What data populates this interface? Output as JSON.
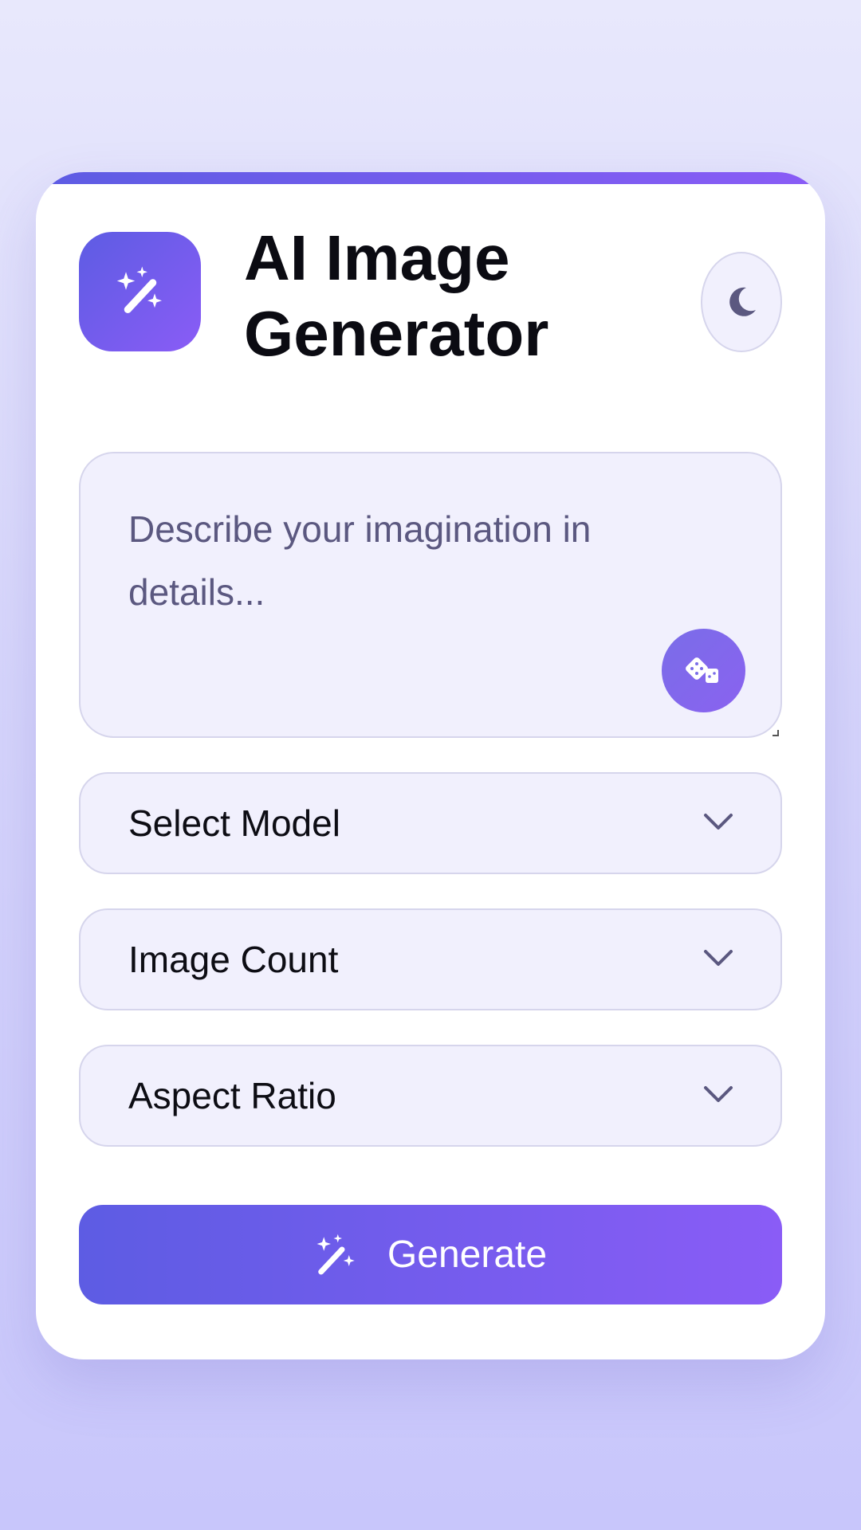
{
  "header": {
    "title": "AI Image Generator",
    "logo_icon": "magic-wand-sparkles-icon",
    "theme_toggle_icon": "moon-icon"
  },
  "prompt": {
    "value": "",
    "placeholder": "Describe your imagination in details...",
    "random_button_icon": "dice-icon"
  },
  "selects": {
    "model": {
      "label": "Select Model",
      "icon": "chevron-down-icon"
    },
    "count": {
      "label": "Image Count",
      "icon": "chevron-down-icon"
    },
    "ratio": {
      "label": "Aspect Ratio",
      "icon": "chevron-down-icon"
    }
  },
  "actions": {
    "generate_label": "Generate",
    "generate_icon": "magic-wand-sparkles-icon"
  },
  "colors": {
    "accent_start": "#5d5ce3",
    "accent_end": "#8a5cf6",
    "field_bg": "#f1f0fd",
    "field_border": "#d6d5ec",
    "placeholder_text": "#5b5880",
    "page_bg_top": "#e8e8fc",
    "page_bg_bottom": "#c8c6fb"
  }
}
